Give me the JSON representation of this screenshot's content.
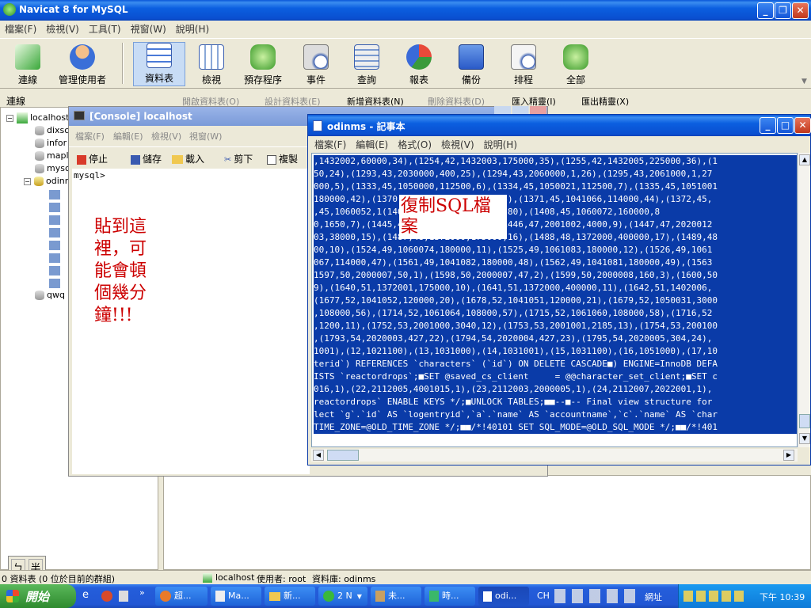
{
  "app": {
    "title": "Navicat 8 for MySQL"
  },
  "menu": [
    "檔案(F)",
    "檢視(V)",
    "工具(T)",
    "視窗(W)",
    "說明(H)"
  ],
  "toolbar": [
    {
      "label": "連線",
      "icon": "connect-icon"
    },
    {
      "label": "管理使用者",
      "icon": "user-icon"
    },
    {
      "label": "資料表",
      "icon": "table-icon"
    },
    {
      "label": "檢視",
      "icon": "view-icon"
    },
    {
      "label": "預存程序",
      "icon": "procedure-icon"
    },
    {
      "label": "事件",
      "icon": "event-icon"
    },
    {
      "label": "查詢",
      "icon": "query-icon"
    },
    {
      "label": "報表",
      "icon": "report-icon"
    },
    {
      "label": "備份",
      "icon": "backup-icon"
    },
    {
      "label": "排程",
      "icon": "schedule-icon"
    },
    {
      "label": "全部",
      "icon": "all-icon"
    }
  ],
  "sidebar": {
    "header": "連線",
    "items": [
      "localhost",
      "dixsc",
      "infor",
      "mapl",
      "mysc",
      "odinm",
      "qwq"
    ]
  },
  "subtoolbar": [
    "開啟資料表(O)",
    "設計資料表(E)",
    "新增資料表(N)",
    "刪除資料表(D)",
    "匯入精靈(I)",
    "匯出精靈(X)"
  ],
  "console": {
    "title": "[Console] localhost",
    "menu": [
      "檔案(F)",
      "編輯(E)",
      "檢視(V)",
      "視窗(W)"
    ],
    "toolbar": [
      "停止",
      "儲存",
      "載入",
      "剪下",
      "複製"
    ],
    "prompt": "mysql>",
    "annotation": "貼到這\n裡，可\n能會頓\n個幾分\n鐘!!!"
  },
  "notepad": {
    "title": "odinms - 記事本",
    "menu": [
      "檔案(F)",
      "編輯(E)",
      "格式(O)",
      "檢視(V)",
      "說明(H)"
    ],
    "annotation": "復制SQL檔\n案",
    "lines": [
      ",1432002,60000,34),(1254,42,1432003,175000,35),(1255,42,1432005,225000,36),(1",
      "50,24),(1293,43,2030000,400,25),(1294,43,2060000,1,26),(1295,43,2061000,1,27",
      "000,5),(1333,45,1050000,112500,6),(1334,45,1050021,112500,7),(1335,45,1051001",
      "180000,42),(1370,45,1041065,130000,43),(1371,45,1041066,114000,44),(1372,45,",
      ",45,1060052,1(1407,45,1060071,160000,80),(1408,45,1060072,160000,8",
      "0,1650,7),(1445,47,2001001,3000,8),(1446,47,2001002,4000,9),(1447,47,2020012",
      "03,38000,15),(1487,48,1372000,175000,16),(1488,48,1372000,400000,17),(1489,48",
      "00,10),(1524,49,1060074,180000,11),(1525,49,1061083,180000,12),(1526,49,1061",
      "067,114000,47),(1561,49,1041082,180000,48),(1562,49,1041081,180000,49),(1563",
      "1597,50,2000007,50,1),(1598,50,2000007,47,2),(1599,50,2000008,160,3),(1600,50",
      "9),(1640,51,1372001,175000,10),(1641,51,1372000,400000,11),(1642,51,1402006,",
      "(1677,52,1041052,120000,20),(1678,52,1041051,120000,21),(1679,52,1050031,3000",
      ",108000,56),(1714,52,1061064,108000,57),(1715,52,1061060,108000,58),(1716,52",
      ",1200,11),(1752,53,2001000,3040,12),(1753,53,2001001,2185,13),(1754,53,200100",
      ",(1793,54,2020003,427,22),(1794,54,2020004,427,23),(1795,54,2020005,304,24),",
      "1001),(12,1021100),(13,1031000),(14,1031001),(15,1031100),(16,1051000),(17,10",
      "terid`) REFERENCES `characters` (`id`) ON DELETE CASCADE■) ENGINE=InnoDB DEFA",
      "ISTS `reactordrops`;■SET @saved_cs_client     = @@character_set_client;■SET c",
      "016,1),(22,2112005,4001015,1),(23,2112003,2000005,1),(24,2112007,2022001,1),",
      "reactordrops` ENABLE KEYS */;■UNLOCK TABLES;■■--■-- Final view structure for",
      "lect `g`.`id` AS `logentryid`,`a`.`name` AS `accountname`,`c`.`name` AS `char",
      "TIME_ZONE=@OLD_TIME_ZONE */;■■/*!40101 SET SQL_MODE=@OLD_SQL_MODE */;■■/*!401"
    ]
  },
  "statusbar": {
    "left": "0 資料表 (0 位於目前的群組)",
    "conn": "localhost",
    "user": "使用者: root",
    "db": "資料庫: odinms"
  },
  "ime": [
    "ㄅ",
    "半"
  ],
  "taskbar": {
    "start": "開始",
    "tasks": [
      "超...",
      "Ma...",
      "新...",
      "2 N",
      "未...",
      "時...",
      "odi..."
    ],
    "tray_lang": "CH",
    "tray_net": "網址",
    "clock": "下午 10:39"
  },
  "colors": {
    "accent": "#0a5ae0",
    "selection": "#0a3ba8",
    "annotation": "#cc0000"
  }
}
